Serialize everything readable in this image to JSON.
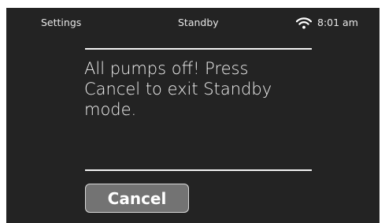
{
  "status_bar": {
    "left_label": "Settings",
    "title": "Standby",
    "wifi_icon": "wifi-icon",
    "time": "8:01 am"
  },
  "dialog": {
    "message": "All pumps off! Press Cancel to exit Standby mode.",
    "cancel_label": "Cancel"
  },
  "colors": {
    "screen_background": "#232323",
    "text": "#f0f0f0",
    "button_fill": "#737373",
    "button_border": "#d9d9d9"
  }
}
